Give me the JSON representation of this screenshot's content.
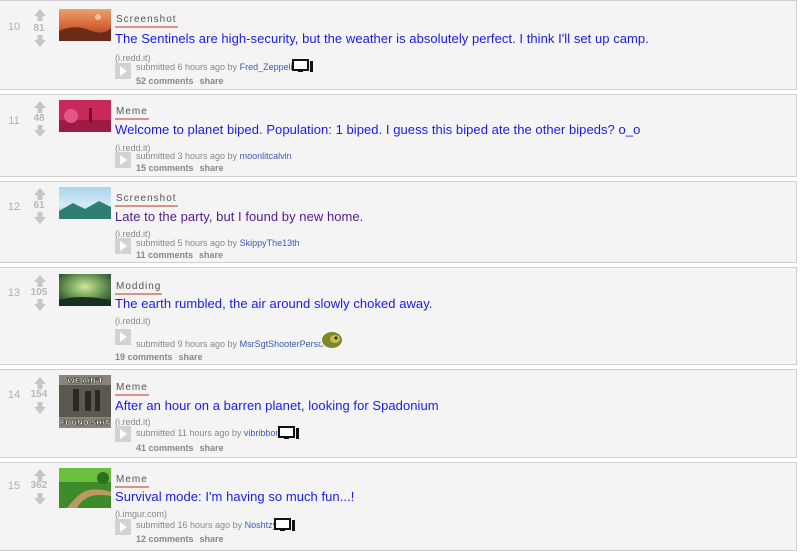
{
  "posts": [
    {
      "rank": "10",
      "score": "81",
      "flair": "Screenshot",
      "title": "The Sentinels are high-security, but the weather is absolutely perfect. I think I'll set up camp.",
      "visited": false,
      "domain": "(i.redd.it)",
      "submitted_prefix": "submitted 6 hours ago by",
      "author": "Fred_Zeppelin",
      "comments": "52 comments",
      "share": "share",
      "user_badge": "monitor-icon",
      "thumb": "thumb-desert-planet"
    },
    {
      "rank": "11",
      "score": "48",
      "flair": "Meme",
      "title": "Welcome to planet biped. Population: 1 biped. I guess this biped ate the other bipeds? o_o",
      "visited": false,
      "domain": "(i.redd.it)",
      "submitted_prefix": "submitted 3 hours ago by",
      "author": "moonlitcalvin",
      "comments": "15 comments",
      "share": "share",
      "user_badge": "",
      "thumb": "thumb-pink-biped"
    },
    {
      "rank": "12",
      "score": "61",
      "flair": "Screenshot",
      "title": "Late to the party, but I found by new home.",
      "visited": true,
      "domain": "(i.redd.it)",
      "submitted_prefix": "submitted 5 hours ago by",
      "author": "SkippyThe13th",
      "comments": "11 comments",
      "share": "share",
      "user_badge": "",
      "thumb": "thumb-blue-sky-planet"
    },
    {
      "rank": "13",
      "score": "105",
      "flair": "Modding",
      "title": "The earth rumbled, the air around slowly choked away.",
      "visited": false,
      "domain": "(i.redd.it)",
      "submitted_prefix": "submitted 9 hours ago by",
      "author": "MsrSgtShooterPerson",
      "comments": "19 comments",
      "share": "share",
      "user_badge": "avatar-icon",
      "thumb": "thumb-green-haze"
    },
    {
      "rank": "14",
      "score": "154",
      "flair": "Meme",
      "title": "After an hour on a barren planet, looking for Spadonium",
      "visited": false,
      "domain": "(i.redd.it)",
      "submitted_prefix": "submitted 11 hours ago by",
      "author": "vibribbon",
      "comments": "41 comments",
      "share": "share",
      "user_badge": "monitor-icon",
      "thumb": "thumb-meme-text",
      "thumb_text_top": "WE AIN'T",
      "thumb_text_bottom": "FOUND SHIT"
    },
    {
      "rank": "15",
      "score": "362",
      "flair": "Meme",
      "title": "Survival mode: I'm having so much fun...!",
      "visited": false,
      "domain": "(i.imgur.com)",
      "submitted_prefix": "submitted 16 hours ago by",
      "author": "Noshtzy",
      "comments": "12 comments",
      "share": "share",
      "user_badge": "monitor-icon",
      "thumb": "thumb-green-path"
    }
  ],
  "colors": {
    "link": "#1a1aee",
    "visited_link": "#551a8b",
    "author": "#3e5ab6",
    "flair_underline": "#d9948a",
    "row_bg": "#f4f4f4"
  }
}
